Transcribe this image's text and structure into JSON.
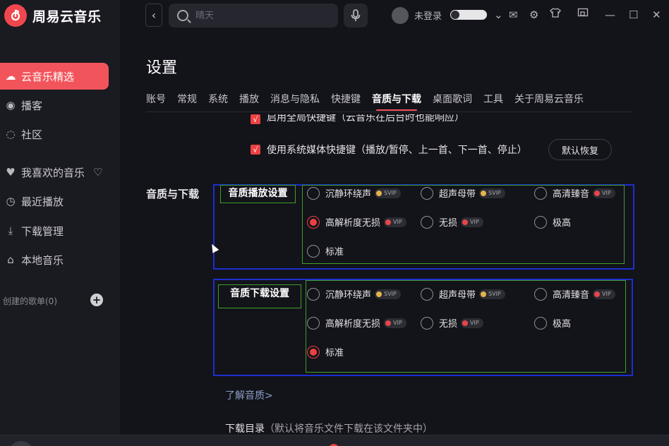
{
  "app": {
    "name": "周易云音乐"
  },
  "sidebar": {
    "items": [
      {
        "label": "云音乐精选",
        "icon": "cloud-music-icon",
        "active": true
      },
      {
        "label": "播客",
        "icon": "podcast-icon"
      },
      {
        "label": "社区",
        "icon": "community-icon"
      },
      {
        "label": "我喜欢的音乐",
        "icon": "heart-icon"
      },
      {
        "label": "最近播放",
        "icon": "clock-icon"
      },
      {
        "label": "下载管理",
        "icon": "download-icon"
      },
      {
        "label": "本地音乐",
        "icon": "local-music-icon"
      }
    ],
    "created_playlists": "创建的歌单(0)"
  },
  "topbar": {
    "search_placeholder": "晴天",
    "login": "未登录"
  },
  "settings": {
    "title": "设置",
    "tabs": [
      "账号",
      "常规",
      "系统",
      "播放",
      "消息与隐私",
      "快捷键",
      "音质与下载",
      "桌面歌词",
      "工具",
      "关于周易云音乐"
    ],
    "active_tab": "音质与下载",
    "shortcuts": {
      "partial_row": "启用全局快捷键（云音乐在后台时也能响应）",
      "media_row": "使用系统媒体快捷键（播放/暂停、上一首、下一首、停止）",
      "restore": "默认恢复",
      "check": "√"
    },
    "section_label": "音质与下载",
    "play_quality": {
      "label": "音质播放设置",
      "options": [
        {
          "label": "沉静环绕声",
          "badge": "SVIP",
          "badge_color": "#e3b34c",
          "checked": false
        },
        {
          "label": "超声母带",
          "badge": "SVIP",
          "badge_color": "#e3b34c",
          "checked": false
        },
        {
          "label": "高清臻音",
          "badge": "VIP",
          "badge_color": "#e6454b",
          "checked": false
        },
        {
          "label": "高解析度无损",
          "badge": "VIP",
          "badge_color": "#e6454b",
          "checked": true
        },
        {
          "label": "无损",
          "badge": "VIP",
          "badge_color": "#e6454b",
          "checked": false
        },
        {
          "label": "极高",
          "badge": "",
          "checked": false
        },
        {
          "label": "标准",
          "badge": "",
          "checked": false
        }
      ]
    },
    "download_quality": {
      "label": "音质下载设置",
      "options": [
        {
          "label": "沉静环绕声",
          "badge": "SVIP",
          "badge_color": "#e3b34c",
          "checked": false
        },
        {
          "label": "超声母带",
          "badge": "SVIP",
          "badge_color": "#e3b34c",
          "checked": false
        },
        {
          "label": "高清臻音",
          "badge": "VIP",
          "badge_color": "#e6454b",
          "checked": false
        },
        {
          "label": "高解析度无损",
          "badge": "VIP",
          "badge_color": "#e6454b",
          "checked": false
        },
        {
          "label": "无损",
          "badge": "VIP",
          "badge_color": "#e6454b",
          "checked": false
        },
        {
          "label": "极高",
          "badge": "",
          "checked": false
        },
        {
          "label": "标准",
          "badge": "",
          "checked": true
        }
      ]
    },
    "learn_more": "了解音质>",
    "download_dir": {
      "label": "下载目录",
      "hint": "（默认将音乐文件下载在该文件夹中）"
    }
  },
  "colors": {
    "accent": "#f2545b",
    "checked": "#ec4141",
    "background": "#13131a",
    "sidebar": "#1a1a21"
  }
}
